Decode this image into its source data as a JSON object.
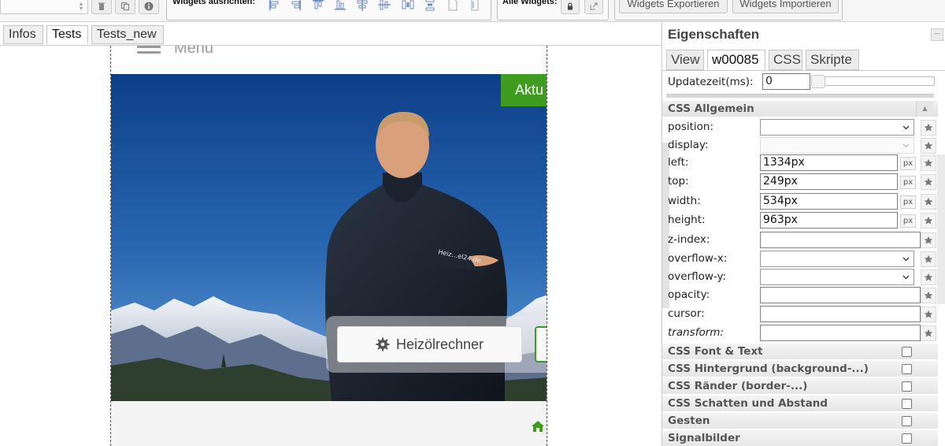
{
  "toolbar": {
    "align_label": "Widgets ausrichten:",
    "all_label": "Alle Widgets:",
    "export_label": "Widgets Exportieren",
    "import_label": "Widgets Importieren"
  },
  "tabs": [
    {
      "label": "Infos"
    },
    {
      "label": "Tests"
    },
    {
      "label": "Tests_new"
    }
  ],
  "canvas": {
    "menu_text": "Menu",
    "aktu_label": "Aktu",
    "calc_label": "Heizölrechner",
    "jacket_text": "Heiz…el24.de"
  },
  "panel": {
    "title": "Eigenschaften",
    "tabs": [
      {
        "label": "View"
      },
      {
        "label": "w00085"
      },
      {
        "label": "CSS"
      },
      {
        "label": "Skripte"
      }
    ],
    "update_label": "Updatezeit(ms):",
    "update_value": "0",
    "css_general": {
      "title": "CSS Allgemein",
      "rows": {
        "position": {
          "label": "position:",
          "value": ""
        },
        "display": {
          "label": "display:",
          "value": ""
        },
        "left": {
          "label": "left:",
          "value": "1334px",
          "unit": "px"
        },
        "top": {
          "label": "top:",
          "value": "249px",
          "unit": "px"
        },
        "width": {
          "label": "width:",
          "value": "534px",
          "unit": "px"
        },
        "height": {
          "label": "height:",
          "value": "963px",
          "unit": "px"
        },
        "zindex": {
          "label": "z-index:",
          "value": ""
        },
        "overflowx": {
          "label": "overflow-x:",
          "value": ""
        },
        "overflowy": {
          "label": "overflow-y:",
          "value": ""
        },
        "opacity": {
          "label": "opacity:",
          "value": ""
        },
        "cursor": {
          "label": "cursor:",
          "value": ""
        },
        "transform": {
          "label": "transform:",
          "value": ""
        }
      }
    },
    "sections": [
      {
        "label": "CSS Font & Text"
      },
      {
        "label": "CSS Hintergrund (background-...)"
      },
      {
        "label": "CSS Ränder (border-...)"
      },
      {
        "label": "CSS Schatten und Abstand"
      },
      {
        "label": "Gesten"
      },
      {
        "label": "Signalbilder"
      }
    ]
  },
  "colors": {
    "accent_green": "#3f9c20",
    "sky_top": "#0d3f88",
    "sky_bottom": "#6aa0d6"
  }
}
